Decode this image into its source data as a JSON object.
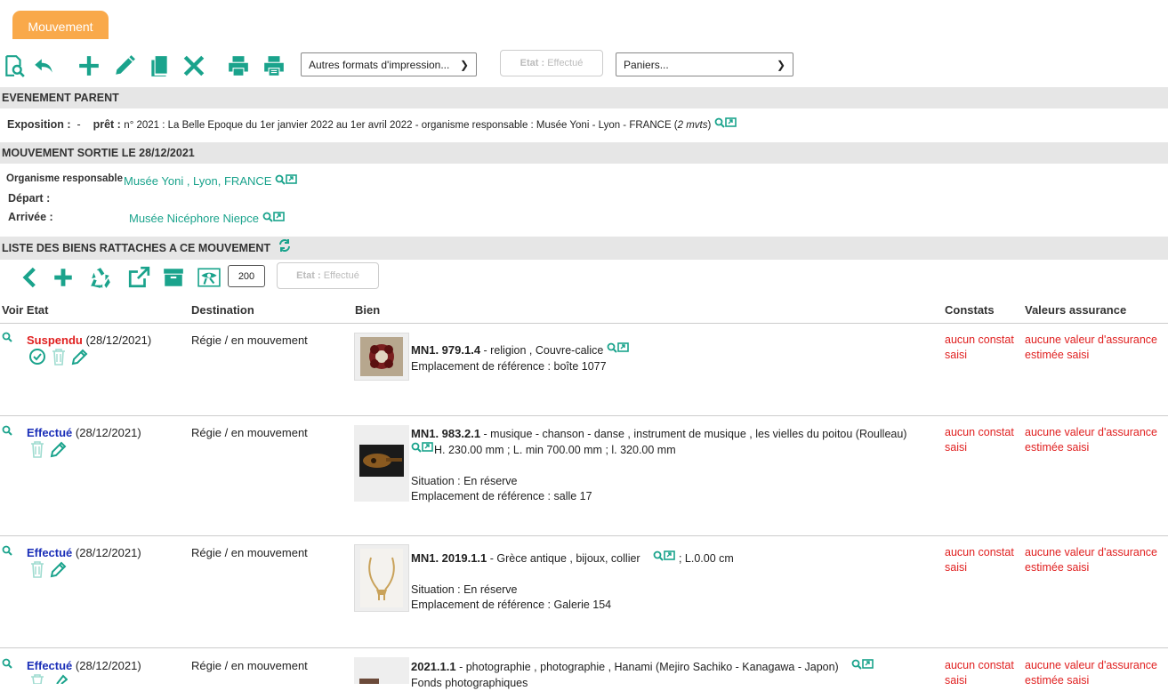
{
  "tab": {
    "label": "Mouvement"
  },
  "toolbar": {
    "formats_select": "Autres formats d'impression...",
    "etat_label": "Etat :",
    "etat_value": "Effectué",
    "paniers_select": "Paniers..."
  },
  "evenement": {
    "header": "EVENEMENT PARENT",
    "exposition_label": "Exposition :",
    "exposition_value": "-",
    "pret_label": "prêt :",
    "pret_text": "n° 2021 : La Belle Epoque du 1er janvier 2022 au 1er avril 2022 - organisme responsable : Musée Yoni - Lyon - FRANCE (",
    "pret_mvts": "2 mvts",
    "pret_close": ")"
  },
  "mouvement": {
    "header": "MOUVEMENT SORTIE LE 28/12/2021",
    "organisme_label": "Organisme responsable",
    "organisme_value": "Musée Yoni , Lyon, FRANCE",
    "depart_label": "Départ :",
    "arrivee_label": "Arrivée :",
    "arrivee_value": "Musée Nicéphore Niepce"
  },
  "liste": {
    "header": "LISTE DES BIENS RATTACHES A CE MOUVEMENT",
    "count": "200",
    "etat_label": "Etat :",
    "etat_value": "Effectué"
  },
  "columns": {
    "voir_etat": "Voir Etat",
    "destination": "Destination",
    "bien": "Bien",
    "constats": "Constats",
    "valeurs": "Valeurs assurance"
  },
  "rows": [
    {
      "status": "Suspendu",
      "date": "(28/12/2021)",
      "destination": "Régie / en mouvement",
      "inv": "MN1. 979.1.4",
      "desc": " - religion , Couvre-calice",
      "line2": "Emplacement de référence : boîte 1077",
      "line3": "",
      "line4": "",
      "constat1": "aucun constat",
      "constat2": "saisi",
      "valeur1": "aucune valeur d'assurance",
      "valeur2": "estimée saisi"
    },
    {
      "status": "Effectué",
      "date": "(28/12/2021)",
      "destination": "Régie / en mouvement",
      "inv": "MN1. 983.2.1",
      "desc": " - musique - chanson - danse , instrument de musique , les vielles du poitou (Roulleau)",
      "line2": "H. 230.00 mm ; L. min 700.00 mm ; l. 320.00 mm",
      "line3": "Situation : En réserve",
      "line4": "Emplacement de référence : salle 17",
      "constat1": "aucun constat",
      "constat2": "saisi",
      "valeur1": "aucune valeur d'assurance",
      "valeur2": "estimée saisi"
    },
    {
      "status": "Effectué",
      "date": "(28/12/2021)",
      "destination": "Régie / en mouvement",
      "inv": "MN1. 2019.1.1",
      "desc": " - Grèce antique , bijoux, collier",
      "desc_after": " ; L.0.00 cm",
      "line3": "Situation : En réserve",
      "line4": "Emplacement de référence : Galerie 154",
      "constat1": "aucun constat",
      "constat2": "saisi",
      "valeur1": "aucune valeur d'assurance",
      "valeur2": "estimée saisi"
    },
    {
      "status": "Effectué",
      "date": "(28/12/2021)",
      "destination": "Régie / en mouvement",
      "inv": "2021.1.1",
      "desc": " - photographie , photographie , Hanami (Mejiro Sachiko - Kanagawa - Japon)",
      "line2": "Fonds photographiques",
      "constat1": "aucun constat",
      "constat2": "saisi",
      "valeur1": "aucune valeur d'assurance",
      "valeur2": "estimée saisi"
    }
  ],
  "colors": {
    "accent": "#1aa38c",
    "tab": "#f9a94a",
    "red": "#e02020",
    "blue": "#1b2fb8"
  }
}
